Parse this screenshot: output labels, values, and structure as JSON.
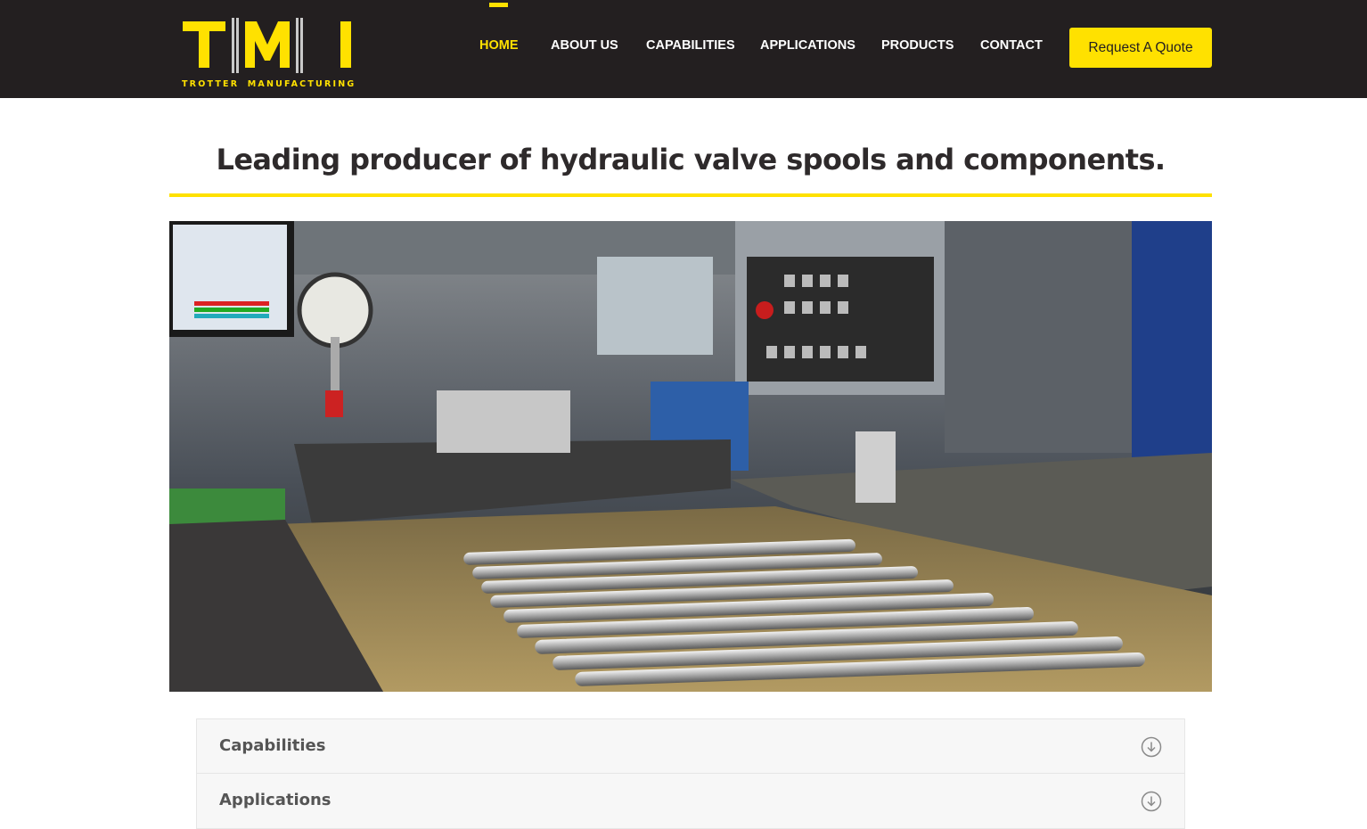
{
  "brand": {
    "logo_text": "TMI",
    "tagline": "TROTTER MANUFACTURING",
    "accent_color": "#ffe100",
    "dark_color": "#231f20"
  },
  "nav": {
    "items": [
      {
        "label": "HOME",
        "active": true
      },
      {
        "label": "ABOUT US",
        "active": false
      },
      {
        "label": "CAPABILITIES",
        "active": false
      },
      {
        "label": "APPLICATIONS",
        "active": false
      },
      {
        "label": "PRODUCTS",
        "active": false
      },
      {
        "label": "CONTACT",
        "active": false
      }
    ],
    "cta_label": "Request A Quote"
  },
  "main": {
    "headline": "Leading producer of hydraulic valve spools and components.",
    "hero_image": "factory-machining-spools-photo",
    "accordion": [
      {
        "title": "Capabilities",
        "icon": "arrow-down-circle-icon"
      },
      {
        "title": "Applications",
        "icon": "arrow-down-circle-icon"
      }
    ]
  }
}
